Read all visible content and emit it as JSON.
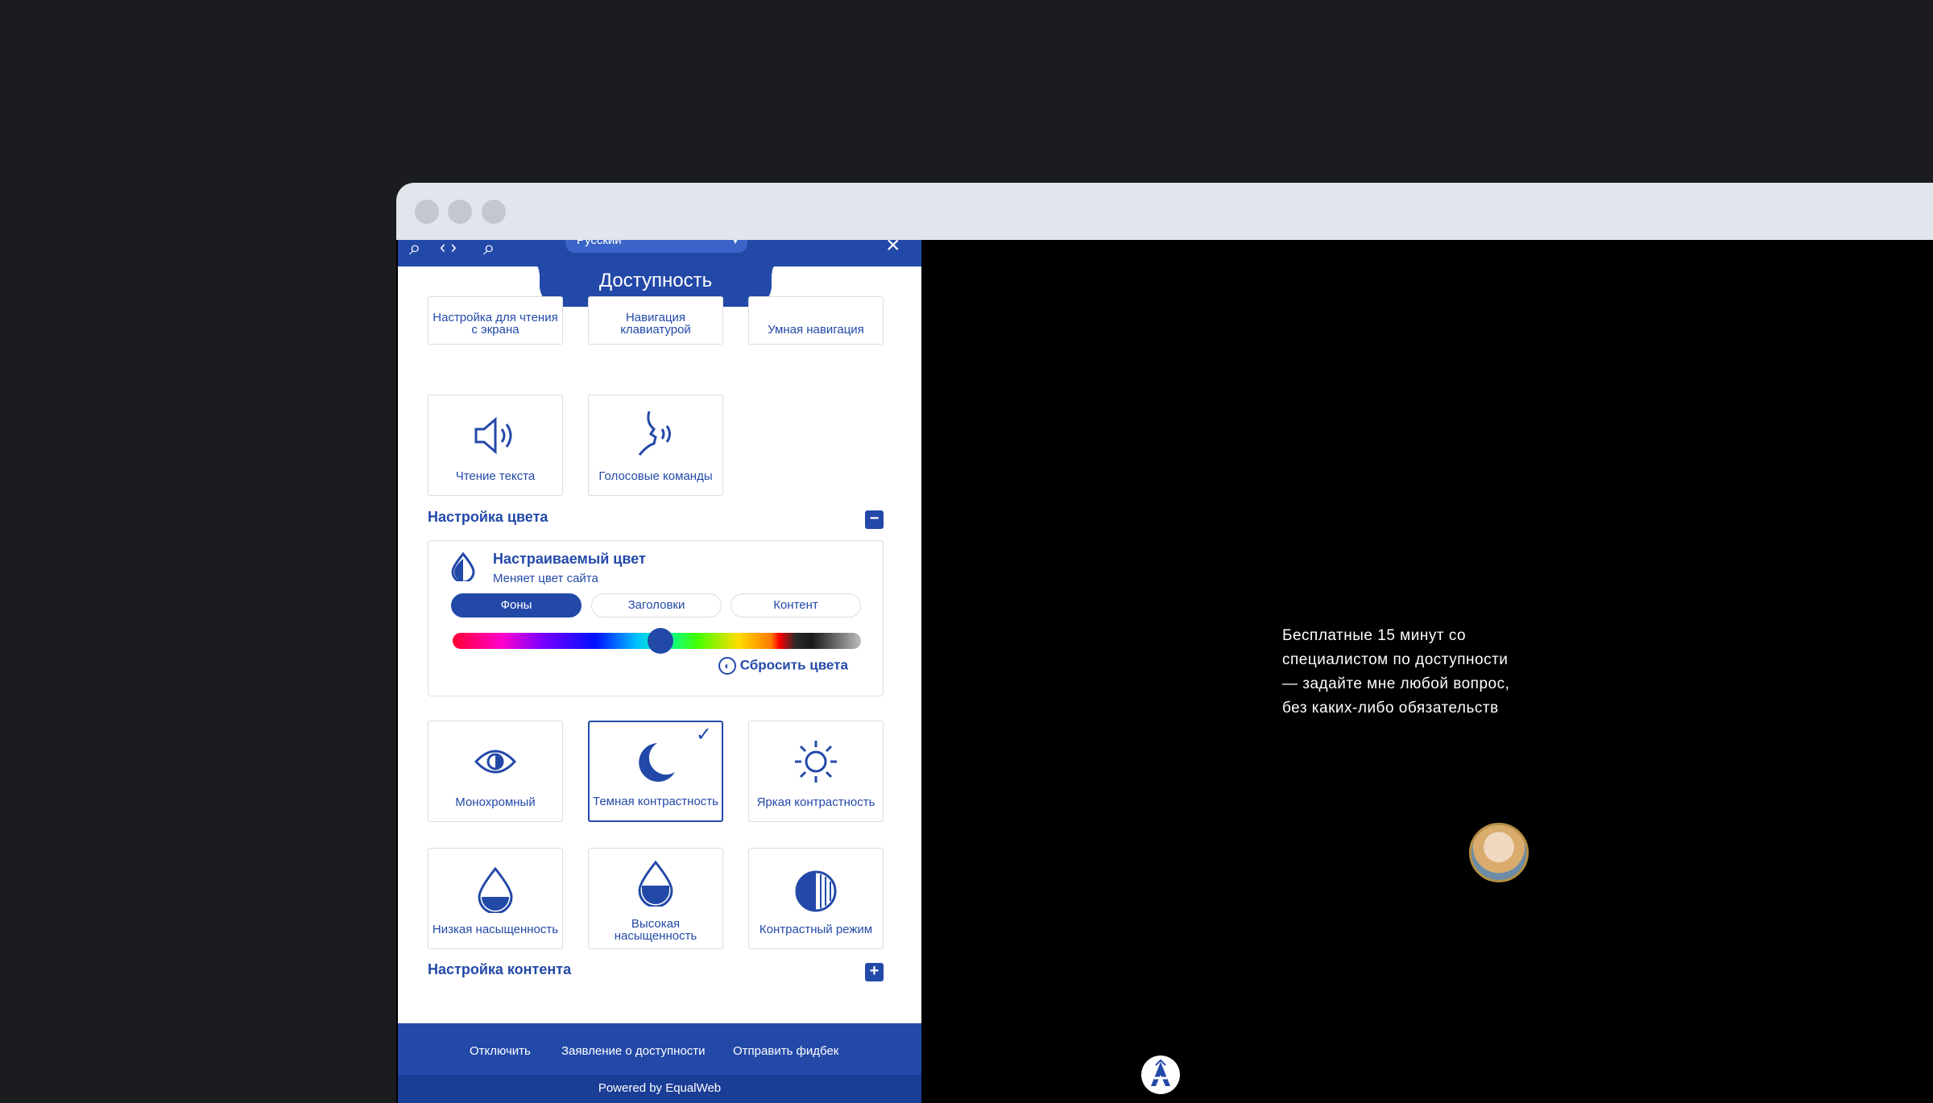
{
  "panel": {
    "language": "Русский",
    "title": "Доступность",
    "top_tiles": [
      "Настройка для чтения с экрана",
      "Навигация клавиатурой",
      "Умная навигация"
    ],
    "tiles_row2": [
      {
        "label": "Чтение текста",
        "icon": "speaker-icon"
      },
      {
        "label": "Голосовые команды",
        "icon": "voice-head-icon"
      }
    ],
    "color_section": {
      "title": "Настройка цвета",
      "toggle": "−",
      "card": {
        "title": "Настраиваемый цвет",
        "subtitle": "Меняет цвет сайта",
        "tabs": [
          "Фоны",
          "Заголовки",
          "Контент"
        ],
        "active_tab": "Фоны",
        "slider_value": 0.5,
        "reset_label": "Сбросить цвета"
      },
      "tiles": [
        {
          "label": "Монохромный",
          "icon": "eye-icon",
          "selected": false
        },
        {
          "label": "Темная контрастность",
          "icon": "moon-icon",
          "selected": true
        },
        {
          "label": "Яркая контрастность",
          "icon": "sun-icon",
          "selected": false
        },
        {
          "label": "Низкая насыщенность",
          "icon": "drop-low-icon",
          "selected": false
        },
        {
          "label": "Высокая насыщенность",
          "icon": "drop-high-icon",
          "selected": false
        },
        {
          "label": "Контрастный режим",
          "icon": "contrast-icon",
          "selected": false
        }
      ]
    },
    "content_section": {
      "title": "Настройка контента",
      "toggle": "+"
    },
    "footer": {
      "links": [
        "Отключить",
        "Заявление о доступности",
        "Отправить фидбек"
      ],
      "powered": "Powered by EqualWeb"
    }
  },
  "chat": {
    "text": "Бесплатные 15 минут со специалистом по доступности — задайте мне любой вопрос, без каких-либо обязательств"
  },
  "colors": {
    "accent": "#2349a8",
    "titlebar": "#e1e5ec",
    "background": "#1b1c20"
  }
}
